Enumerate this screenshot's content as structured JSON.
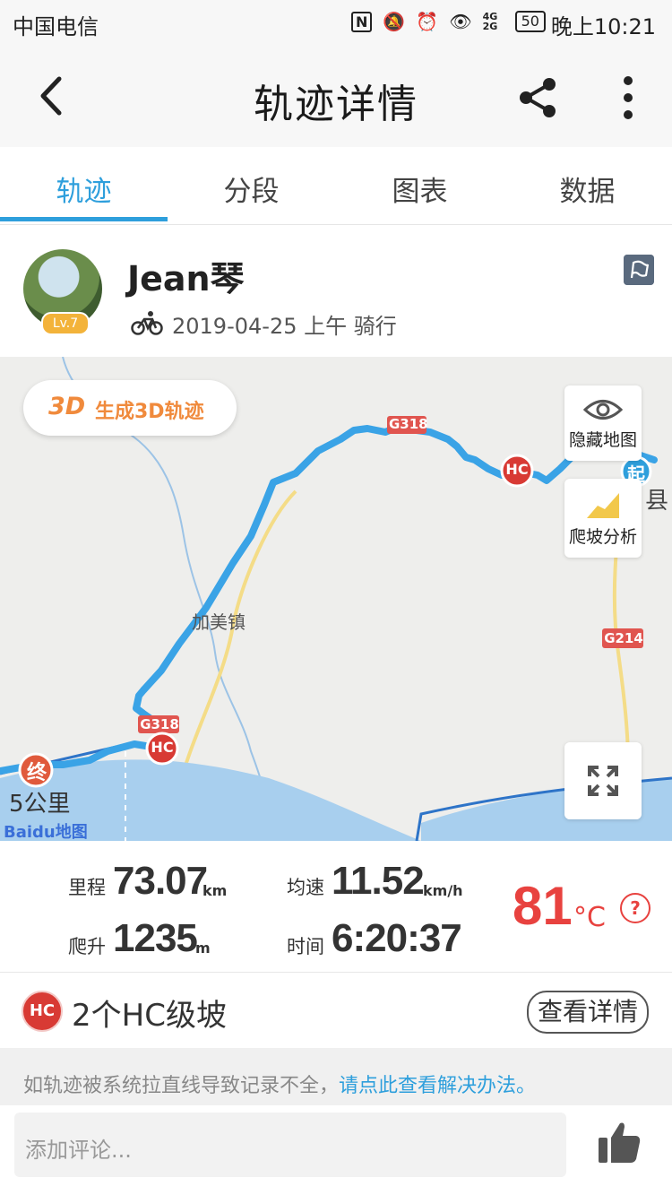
{
  "status": {
    "carrier": "中国电信",
    "nfc": "N",
    "net": "4G 2G",
    "battery": "50",
    "time": "晚上10:21"
  },
  "header": {
    "title": "轨迹详情"
  },
  "tabs": [
    {
      "label": "轨迹"
    },
    {
      "label": "分段"
    },
    {
      "label": "图表"
    },
    {
      "label": "数据"
    }
  ],
  "user": {
    "name": "Jean琴",
    "level": "Lv.7",
    "meta": "2019-04-25 上午 骑行"
  },
  "map": {
    "btn3d_icon": "3D",
    "btn3d_label": "生成3D轨迹",
    "hide_map": "隐藏地图",
    "climb": "爬坡分析",
    "town": "加美镇",
    "road_top": "G318",
    "road_left": "G318",
    "road_right": "G214",
    "county": "县",
    "start_marker": "起",
    "end_marker": "终",
    "hc_marker": "HC",
    "scale": "5公里",
    "attribution": "Baidu地图"
  },
  "stats": {
    "distance_label": "里程",
    "distance_value": "73.07",
    "distance_unit": "km",
    "speed_label": "均速",
    "speed_value": "11.52",
    "speed_unit": "km/h",
    "climb_label": "爬升",
    "climb_value": "1235",
    "climb_unit": "m",
    "time_label": "时间",
    "time_value": "6:20:37",
    "temperature": "81",
    "temperature_unit": "°C",
    "help": "?"
  },
  "hc": {
    "badge": "HC",
    "text": "2个HC级坡",
    "button": "查看详情"
  },
  "notice": {
    "text": "如轨迹被系统拉直线导致记录不全，",
    "link": "请点此查看解决办法。"
  },
  "comment": {
    "placeholder": "添加评论..."
  },
  "colors": {
    "accent": "#2e9fdc",
    "track": "#3aa3e6",
    "hc": "#d83a34",
    "temperature": "#e8423f",
    "orange": "#f08a3c"
  }
}
